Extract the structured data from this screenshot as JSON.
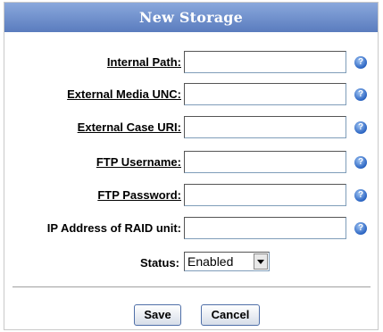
{
  "dialog": {
    "title": "New Storage"
  },
  "fields": [
    {
      "label": "Internal Path:",
      "value": ""
    },
    {
      "label": "External Media UNC:",
      "value": ""
    },
    {
      "label": "External Case URI:",
      "value": ""
    },
    {
      "label": "FTP Username:",
      "value": ""
    },
    {
      "label": "FTP Password:",
      "value": ""
    },
    {
      "label": "IP Address of RAID unit:",
      "value": ""
    }
  ],
  "help_icon": {
    "glyph": "?",
    "icon": "help-icon",
    "color": "#2a64c2"
  },
  "status": {
    "label": "Status:",
    "selected": "Enabled"
  },
  "buttons": {
    "save": "Save",
    "cancel": "Cancel"
  },
  "colors": {
    "title_bar": "#6a8cc8",
    "button_border": "#4f6fa8"
  }
}
